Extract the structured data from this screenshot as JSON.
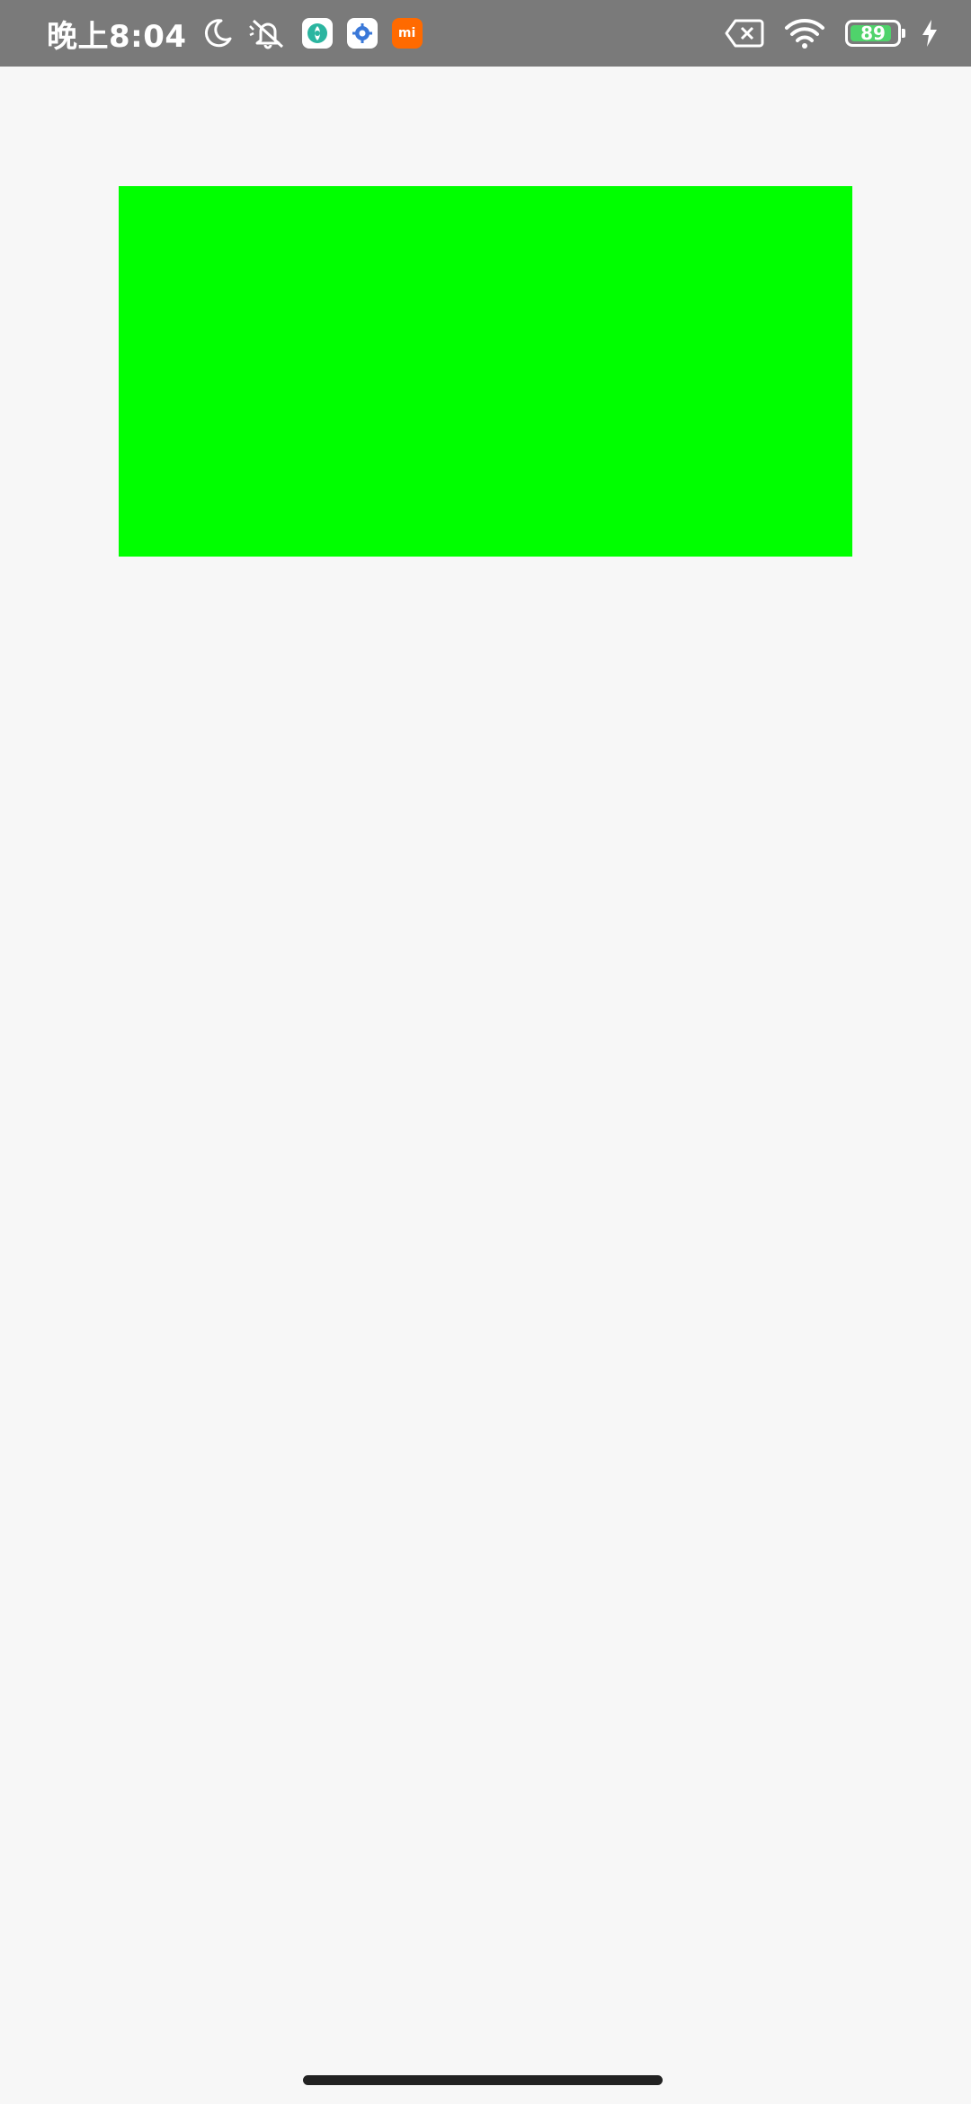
{
  "status_bar": {
    "time": "晚上8:04",
    "battery_level_percent": 89,
    "battery_text": "89",
    "left_icons": [
      "moon-icon",
      "mute-icon",
      "app-icon-teal",
      "app-icon-settings",
      "mi-icon"
    ],
    "right_icons": [
      "sim-x-icon",
      "wifi-icon",
      "battery-icon",
      "charging-icon"
    ],
    "mi_label": "mi",
    "background_color": "#7a7a7a"
  },
  "content": {
    "box_color": "#00ff00"
  },
  "navigation": {
    "home_indicator_color": "#222222"
  }
}
